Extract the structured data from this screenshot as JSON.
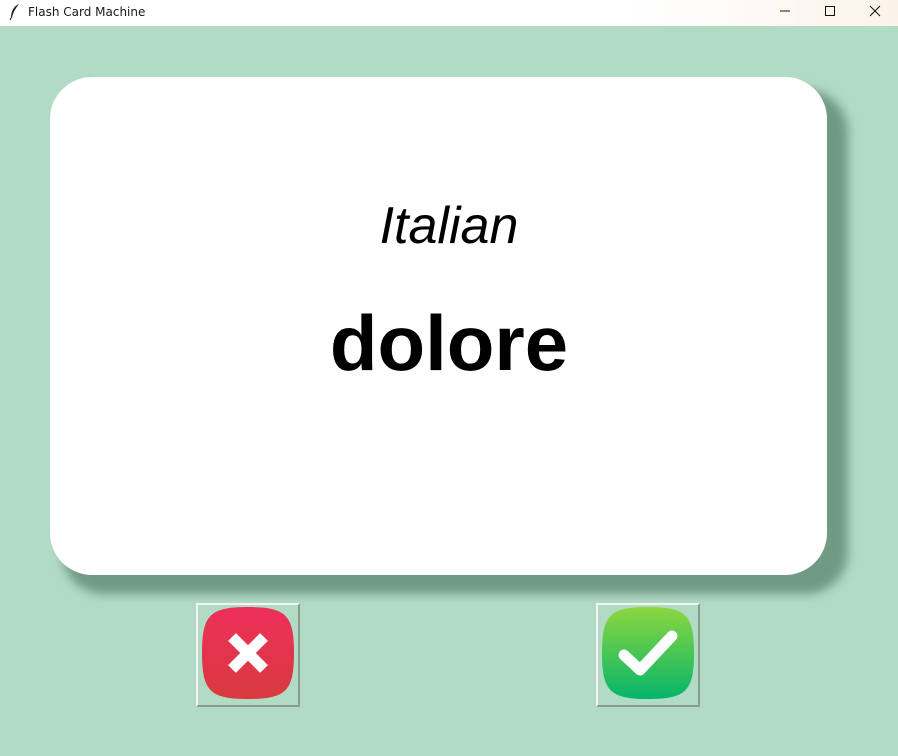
{
  "window": {
    "title": "Flash Card Machine",
    "app_icon": "feather-icon",
    "controls": [
      "minimize-icon",
      "maximize-icon",
      "close-icon"
    ]
  },
  "card": {
    "language": "Italian",
    "word": "dolore"
  },
  "buttons": {
    "wrong_icon": "cross-icon",
    "right_icon": "checkmark-icon"
  },
  "colors": {
    "background": "#b1dbc5",
    "card": "#ffffff",
    "wrong": "#e8334f",
    "right": "#22c25e"
  }
}
